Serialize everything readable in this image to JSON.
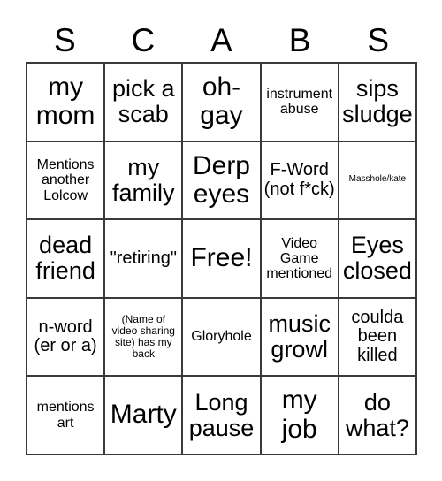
{
  "card": {
    "header_letters": [
      "S",
      "C",
      "A",
      "B",
      "S"
    ],
    "size": 5,
    "colors": {
      "background": "#ffffff",
      "text": "#000000",
      "border": "#3a3a3a"
    },
    "rows": [
      [
        {
          "text": "my mom",
          "size": "fs-xxl"
        },
        {
          "text": "pick a scab",
          "size": "fs-xl"
        },
        {
          "text": "oh-gay",
          "size": "fs-xxl"
        },
        {
          "text": "instrument abuse",
          "size": "fs-s"
        },
        {
          "text": "sips sludge",
          "size": "fs-xl"
        }
      ],
      [
        {
          "text": "Mentions another Lolcow",
          "size": "fs-s"
        },
        {
          "text": "my family",
          "size": "fs-xl"
        },
        {
          "text": "Derp eyes",
          "size": "fs-xxl"
        },
        {
          "text": "F-Word (not f*ck)",
          "size": "fs-m"
        },
        {
          "text": "Masshole/kate",
          "size": "fs-tiny"
        }
      ],
      [
        {
          "text": "dead friend",
          "size": "fs-xl"
        },
        {
          "text": "\"retiring\"",
          "size": "fs-m"
        },
        {
          "text": "Free!",
          "size": "fs-xxl"
        },
        {
          "text": "Video Game mentioned",
          "size": "fs-s"
        },
        {
          "text": "Eyes closed",
          "size": "fs-xl"
        }
      ],
      [
        {
          "text": "n-word (er or a)",
          "size": "fs-m"
        },
        {
          "text": "(Name of video sharing site) has my back",
          "size": "fs-xxs"
        },
        {
          "text": "Gloryhole",
          "size": "fs-s"
        },
        {
          "text": "music growl",
          "size": "fs-xl"
        },
        {
          "text": "coulda been killed",
          "size": "fs-m"
        }
      ],
      [
        {
          "text": "mentions art",
          "size": "fs-s"
        },
        {
          "text": "Marty",
          "size": "fs-xxl"
        },
        {
          "text": "Long pause",
          "size": "fs-xl"
        },
        {
          "text": "my job",
          "size": "fs-xxl"
        },
        {
          "text": "do what?",
          "size": "fs-xl"
        }
      ]
    ]
  }
}
